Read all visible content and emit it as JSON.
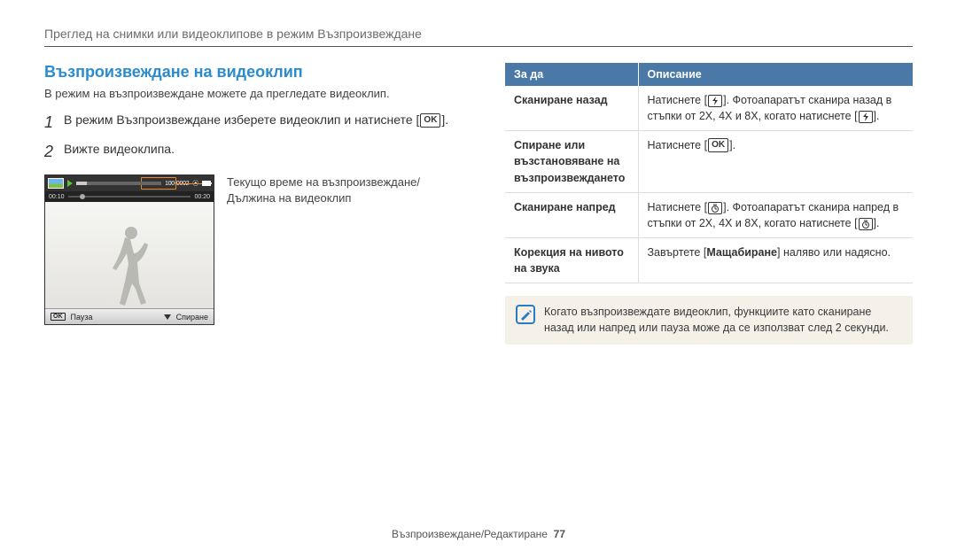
{
  "breadcrumb": "Преглед на снимки или видеоклипове в режим Възпроизвеждане",
  "section_title": "Възпроизвеждане на видеоклип",
  "intro": "В режим на възпроизвеждане можете да прегледате видеоклип.",
  "steps": [
    {
      "num": "1",
      "text_before": "В режим Възпроизвеждане изберете видеоклип и натиснете [",
      "btn": "OK",
      "text_after": "]."
    },
    {
      "num": "2",
      "text_before": "Вижте видеоклипа.",
      "btn": "",
      "text_after": ""
    }
  ],
  "preview": {
    "elapsed": "00:10",
    "total": "00:20",
    "counter": "100-0002",
    "bottom_left": "Пауза",
    "bottom_right": "Спиране"
  },
  "caption_line1": "Текущо време на възпроизвеждане/",
  "caption_line2": "Дължина на видеоклип",
  "table": {
    "header_left": "За да",
    "header_right": "Описание",
    "rows": [
      {
        "label": "Сканиране назад",
        "desc_before": "Натиснете [",
        "glyph": "flash",
        "desc_after": "]. Фотоапаратът сканира назад в стъпки от 2X, 4X и 8X, когато натиснете [",
        "glyph2": "flash",
        "desc_after2": "]."
      },
      {
        "label": "Спиране или възстановяване на възпроизвеждането",
        "desc_before": "Натиснете [",
        "glyph": "OK",
        "desc_after": "].",
        "glyph2": "",
        "desc_after2": ""
      },
      {
        "label": "Сканиране напред",
        "desc_before": "Натиснете [",
        "glyph": "timer",
        "desc_after": "]. Фотоапаратът сканира напред в стъпки от 2X, 4X и 8X, когато натиснете [",
        "glyph2": "timer",
        "desc_after2": "]."
      },
      {
        "label": "Корекция на нивото на звука",
        "desc_before": "Завъртете [",
        "glyph_text": "Мащабиране",
        "desc_after": "] наляво или надясно.",
        "glyph2": "",
        "desc_after2": ""
      }
    ]
  },
  "note_text": "Когато възпроизвеждате видеоклип, функциите като сканиране назад или напред или пауза може да се използват след 2 секунди.",
  "footer_text": "Възпроизвеждане/Редактиране",
  "footer_page": "77"
}
